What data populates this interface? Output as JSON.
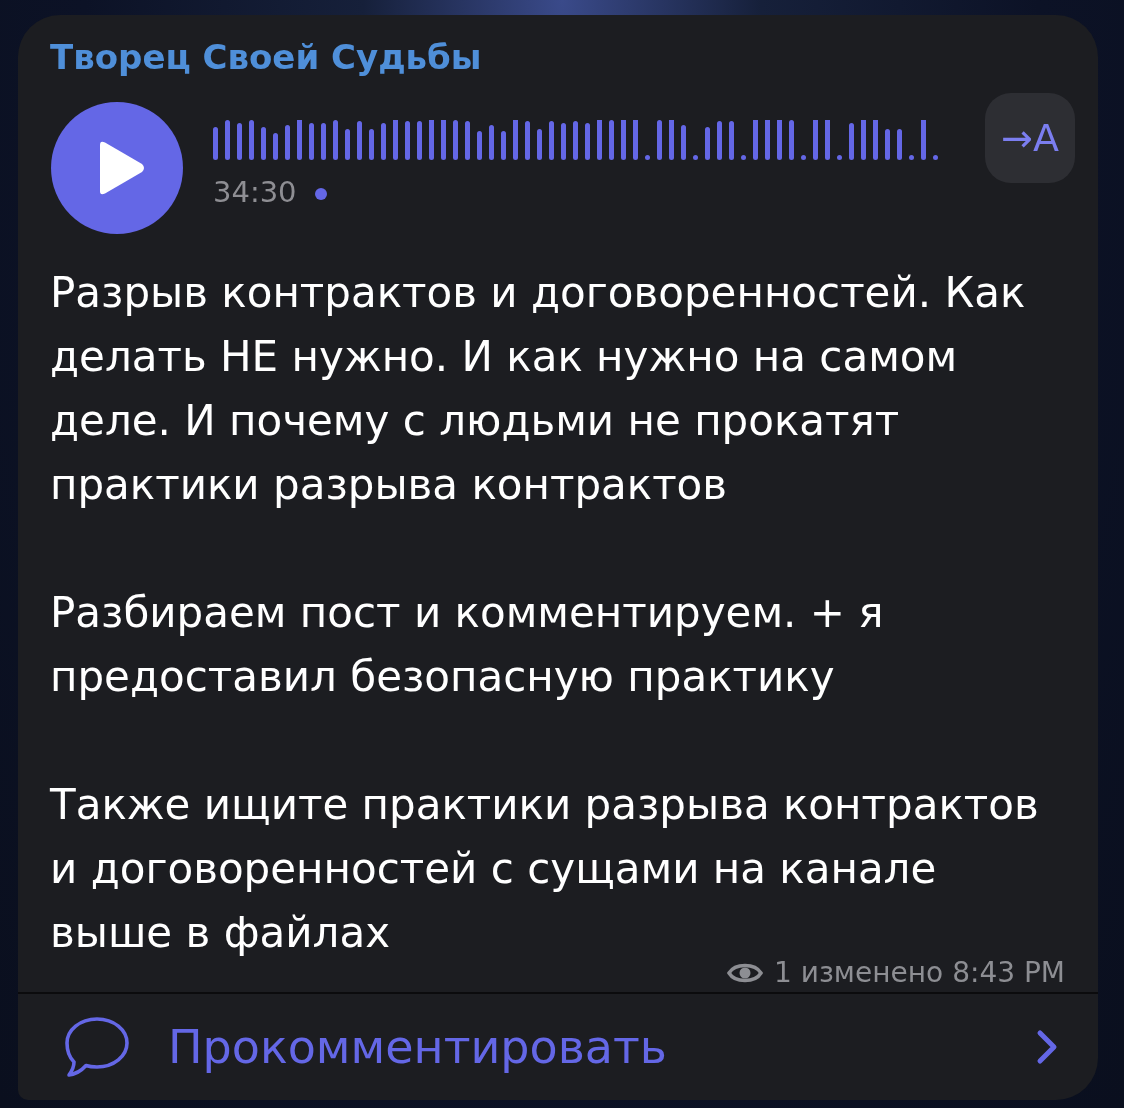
{
  "channel": {
    "name": "Творец Своей Судьбы"
  },
  "voice_message": {
    "playing": false,
    "duration": "34:30",
    "listened": false,
    "transcribe_button": {
      "label": "→A"
    }
  },
  "message": {
    "paragraphs": [
      "Разрыв контрактов и договоренностей. Как делать НЕ нужно. И как нужно на самом деле. И почему с людьми не прокатят практики разрыва контрактов",
      "Разбираем пост и комментируем. + я предоставил безопасную практику",
      "Также ищите практики разрыва контрактов и договоренностей с сущами на канале выше в файлах"
    ]
  },
  "meta": {
    "views": "1",
    "edited": "изменено",
    "time": "8:43 PM"
  },
  "comments_button": {
    "label": "Прокомментировать"
  }
}
